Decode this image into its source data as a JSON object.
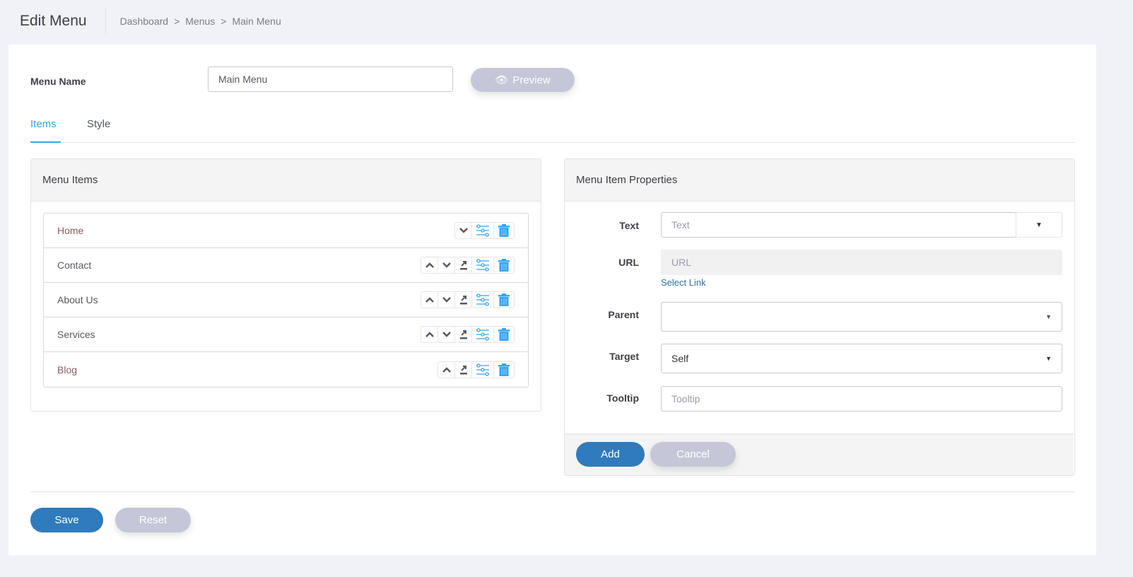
{
  "header": {
    "title": "Edit Menu",
    "breadcrumb": [
      "Dashboard",
      "Menus",
      "Main Menu"
    ],
    "separator": ">"
  },
  "form": {
    "menu_name_label": "Menu Name",
    "menu_name_value": "Main Menu",
    "preview_label": "Preview"
  },
  "tabs": [
    {
      "label": "Items",
      "active": true
    },
    {
      "label": "Style",
      "active": false
    }
  ],
  "menu_items": {
    "title": "Menu Items",
    "items": [
      {
        "label": "Home",
        "actions": [
          "down",
          "settings",
          "delete"
        ]
      },
      {
        "label": "Contact",
        "actions": [
          "up",
          "down",
          "indent",
          "settings",
          "delete"
        ]
      },
      {
        "label": "About Us",
        "actions": [
          "up",
          "down",
          "indent",
          "settings",
          "delete"
        ]
      },
      {
        "label": "Services",
        "actions": [
          "up",
          "down",
          "indent",
          "settings",
          "delete"
        ]
      },
      {
        "label": "Blog",
        "actions": [
          "up",
          "indent",
          "settings",
          "delete"
        ]
      }
    ]
  },
  "properties": {
    "title": "Menu Item Properties",
    "text_label": "Text",
    "text_placeholder": "Text",
    "url_label": "URL",
    "url_placeholder": "URL",
    "select_link": "Select Link",
    "parent_label": "Parent",
    "parent_value": "",
    "target_label": "Target",
    "target_value": "Self",
    "tooltip_label": "Tooltip",
    "tooltip_placeholder": "Tooltip",
    "add_label": "Add",
    "cancel_label": "Cancel"
  },
  "footer": {
    "save_label": "Save",
    "reset_label": "Reset"
  },
  "colors": {
    "accent": "#34bfa3",
    "primary": "#2f7bbd",
    "tab_active": "#36a3f7",
    "icon_blue": "#36a3f7",
    "secondary": "#c5c7d9"
  }
}
